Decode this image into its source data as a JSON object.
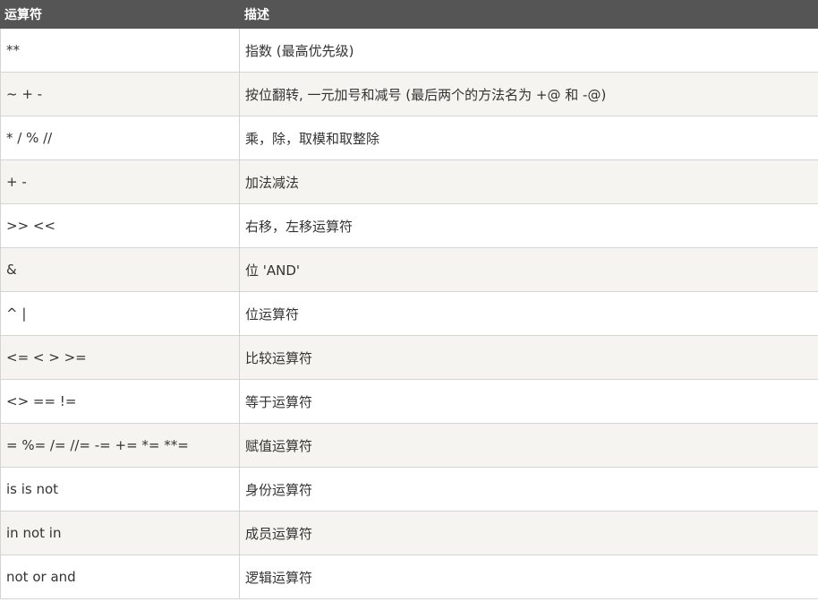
{
  "table": {
    "headers": [
      "运算符",
      "描述"
    ],
    "rows": [
      {
        "operator": "**",
        "description": "指数 (最高优先级)"
      },
      {
        "operator": "~ + -",
        "description": "按位翻转, 一元加号和减号 (最后两个的方法名为 +@ 和 -@)"
      },
      {
        "operator": "* / % //",
        "description": "乘，除，取模和取整除"
      },
      {
        "operator": "+ -",
        "description": "加法减法"
      },
      {
        "operator": ">> <<",
        "description": "右移，左移运算符"
      },
      {
        "operator": "&",
        "description": "位 'AND'"
      },
      {
        "operator": "^ |",
        "description": "位运算符"
      },
      {
        "operator": "<= < > >=",
        "description": "比较运算符"
      },
      {
        "operator": "<> == !=",
        "description": "等于运算符"
      },
      {
        "operator": "= %= /= //= -= += *= **=",
        "description": "赋值运算符"
      },
      {
        "operator": "is is not",
        "description": "身份运算符"
      },
      {
        "operator": "in not in",
        "description": "成员运算符"
      },
      {
        "operator": "not or and",
        "description": "逻辑运算符"
      }
    ]
  },
  "colors": {
    "header_bg": "#555555",
    "header_text": "#ffffff",
    "row_alt_bg": "#f6f4f0",
    "border": "#d4d4d4",
    "cell_text": "#333333"
  }
}
